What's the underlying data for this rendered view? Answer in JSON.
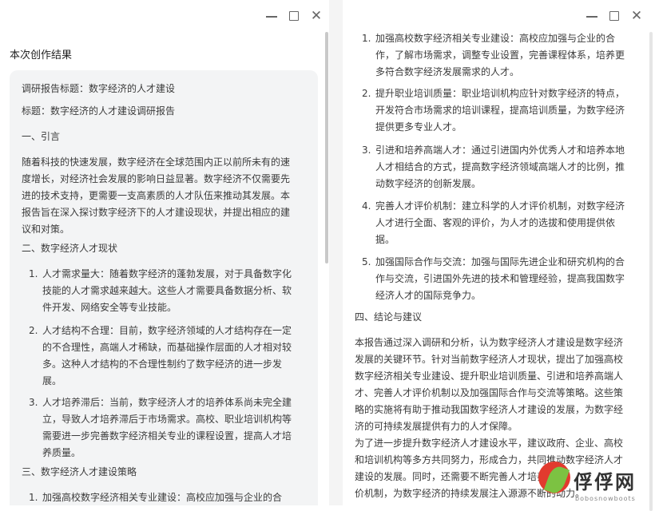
{
  "window_controls": {
    "minimize": "—",
    "maximize": "",
    "close": "✕"
  },
  "left": {
    "panel_title": "本次创作结果",
    "report_title": "调研报告标题：数字经济的人才建设",
    "title_line": "标题：数字经济的人才建设调研报告",
    "sec1_heading": "一、引言",
    "sec1_lines": [
      "随着科技的快速发展，数字经济在全球范围内正以前所未有的速",
      "度增长，对经济社会发展的影响日益显著。数字经济不仅需要先",
      "进的技术支持，更需要一支高素质的人才队伍来推动其发展。本",
      "报告旨在深入探讨数字经济下的人才建设现状，并提出相应的建",
      "议和对策。"
    ],
    "sec2_heading": "二、数字经济人才现状",
    "sec2_items": [
      {
        "num": "1.",
        "lines": [
          "人才需求量大：随着数字经济的蓬勃发展，对于具备数字化",
          "技能的人才需求越来越大。这些人才需要具备数据分析、软",
          "件开发、网络安全等专业技能。"
        ]
      },
      {
        "num": "2.",
        "lines": [
          "人才结构不合理：目前，数字经济领域的人才结构存在一定",
          "的不合理性，高端人才稀缺，而基础操作层面的人才相对较",
          "多。这种人才结构的不合理性制约了数字经济的进一步发",
          "展。"
        ]
      },
      {
        "num": "3.",
        "lines": [
          "人才培养滞后：当前，数字经济人才的培养体系尚未完全建",
          "立，导致人才培养滞后于市场需求。高校、职业培训机构等",
          "需要进一步完善数字经济相关专业的课程设置，提高人才培",
          "养质量。"
        ]
      }
    ],
    "sec3_heading": "三、数字经济人才建设策略",
    "sec3_first": {
      "num": "1.",
      "line": "加强高校数字经济相关专业建设：高校应加强与企业的合"
    }
  },
  "right": {
    "items": [
      {
        "num": "1.",
        "lines": [
          "加强高校数字经济相关专业建设：高校应加强与企业的合",
          "作，了解市场需求，调整专业设置，完善课程体系，培养更",
          "多符合数字经济发展需求的人才。"
        ]
      },
      {
        "num": "2.",
        "lines": [
          "提升职业培训质量：职业培训机构应针对数字经济的特点，",
          "开发符合市场需求的培训课程，提高培训质量，为数字经济",
          "提供更多专业人才。"
        ]
      },
      {
        "num": "3.",
        "lines": [
          "引进和培养高端人才：通过引进国内外优秀人才和培养本地",
          "人才相结合的方式，提高数字经济领域高端人才的比例，推",
          "动数字经济的创新发展。"
        ]
      },
      {
        "num": "4.",
        "lines": [
          "完善人才评价机制：建立科学的人才评价机制，对数字经济",
          "人才进行全面、客观的评价，为人才的选拔和使用提供依",
          "据。"
        ]
      },
      {
        "num": "5.",
        "lines": [
          "加强国际合作与交流：加强与国际先进企业和研究机构的合",
          "作与交流，引进国外先进的技术和管理经验，提高我国数字",
          "经济人才的国际竞争力。"
        ]
      }
    ],
    "sec4_heading": "四、结论与建议",
    "p1_lines": [
      "本报告通过深入调研和分析，认为数字经济人才建设是数字经济",
      "发展的关键环节。针对当前数字经济人才现状，提出了加强高校",
      "数字经济相关专业建设、提升职业培训质量、引进和培养高端人",
      "才、完善人才评价机制以及加强国际合作与交流等策略。这些策",
      "略的实施将有助于推动我国数字经济人才建设的发展，为数字经",
      "济的可持续发展提供有力的人才保障。"
    ],
    "p2_lines": [
      "为了进一步提升数字经济人才建设水平，建议政府、企业、高校",
      "和培训机构等多方共同努力，形成合力，共同推动数字经济人才",
      "建设的发展。同时，还需要不断完善人才培养",
      "价机制，为数字经济的持续发展注入源源不断的动力。"
    ]
  },
  "watermark": {
    "text": "俘俘网",
    "sub": "bobosnowboots"
  }
}
